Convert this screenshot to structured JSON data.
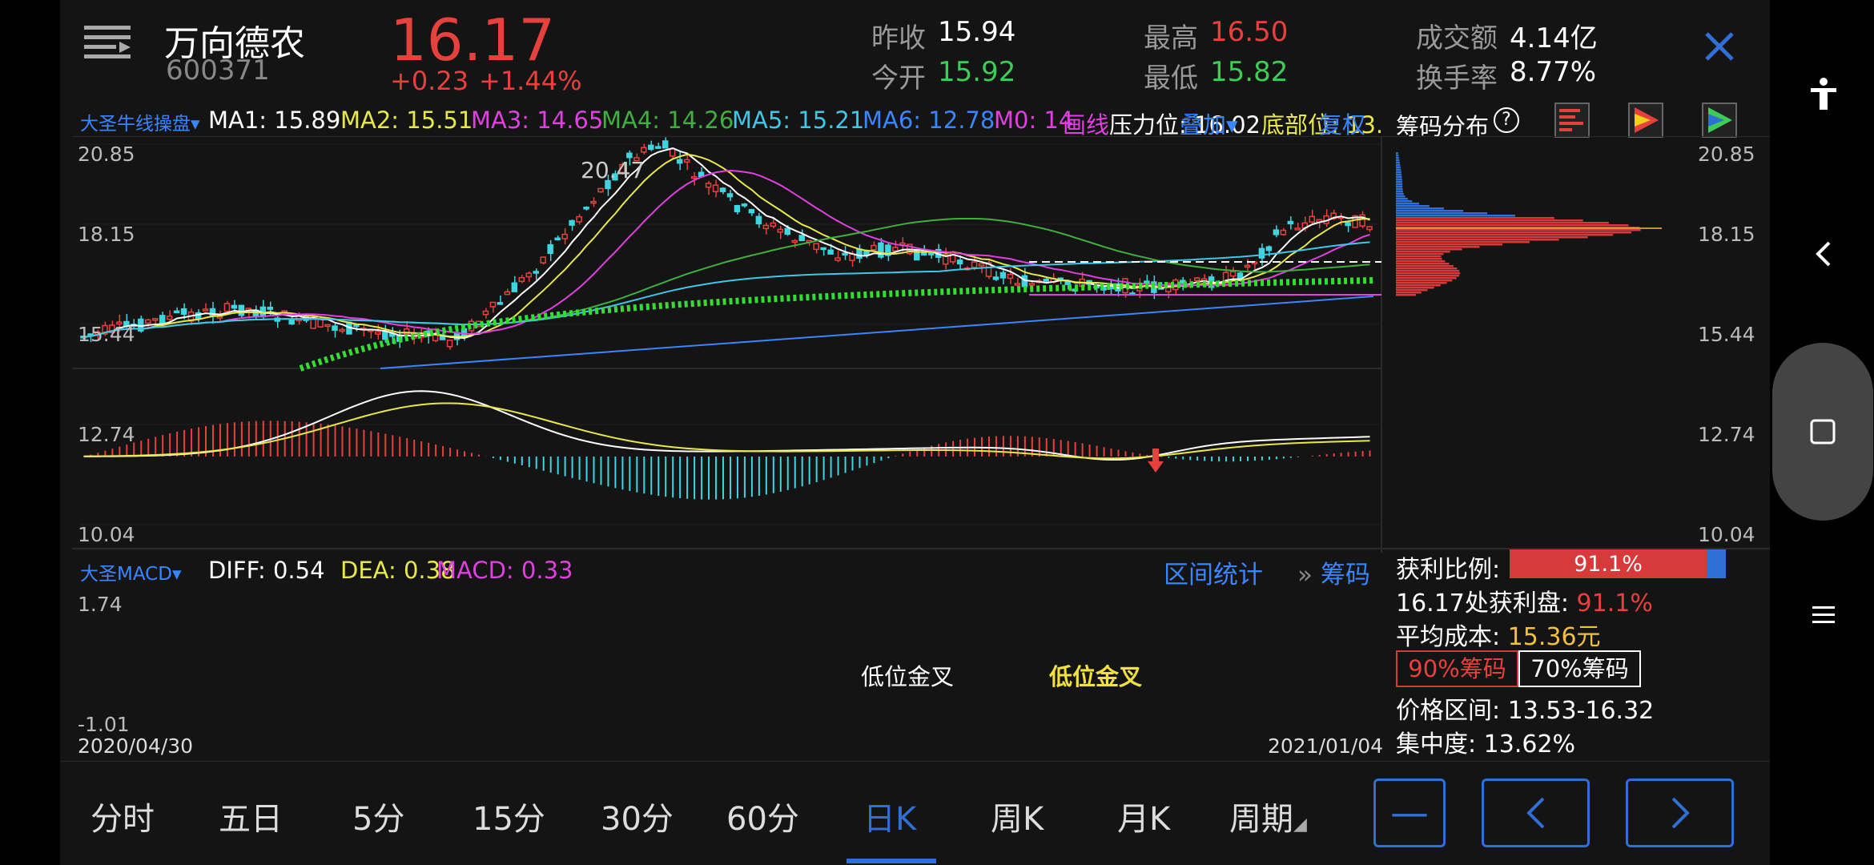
{
  "header": {
    "stock_name": "万向德农",
    "stock_code": "600371",
    "price": "16.17",
    "change": "+0.23",
    "change_pct": "+1.44%",
    "stats": [
      {
        "label": "昨收",
        "value": "15.94",
        "color": "#ffffff"
      },
      {
        "label": "今开",
        "value": "15.92",
        "color": "#3dcc55"
      },
      {
        "label": "最高",
        "value": "16.50",
        "color": "#e8413d"
      },
      {
        "label": "最低",
        "value": "15.82",
        "color": "#3dcc55"
      },
      {
        "label": "成交额",
        "value": "4.14亿",
        "color": "#ffffff"
      },
      {
        "label": "换手率",
        "value": "8.77%",
        "color": "#ffffff"
      }
    ]
  },
  "ma_bar": {
    "indicator": "大圣牛线操盘▾",
    "items": [
      {
        "text": "MA1: 15.89",
        "color": "#ffffff"
      },
      {
        "text": "MA2: 15.51",
        "color": "#e8e84a"
      },
      {
        "text": "MA3: 14.65",
        "color": "#e040e0"
      },
      {
        "text": "MA4: 14.26",
        "color": "#3fb03f"
      },
      {
        "text": "MA5: 15.21",
        "color": "#3fc6e8"
      },
      {
        "text": "MA6: 12.78",
        "color": "#3a86ff"
      },
      {
        "text": "M0: 14",
        "color": "#e040e0"
      },
      {
        "text": "画线",
        "color": "#e040e0"
      },
      {
        "text": "压力位: 16.02",
        "color": "#ffffff"
      },
      {
        "text": "叠加▾",
        "color": "#3a86ff"
      },
      {
        "text": "底部位: 13.",
        "color": "#e8e84a"
      },
      {
        "text": "复权",
        "color": "#3a86ff"
      }
    ]
  },
  "chip_panel": {
    "title": "筹码分布",
    "help": "?",
    "profit_ratio_label": "获利比例:",
    "profit_ratio_value": "91.1%",
    "profit_at_label": "16.17处获利盘:",
    "profit_at_value": "91.1%",
    "avg_cost_label": "平均成本:",
    "avg_cost_value": "15.36元",
    "tab_90": "90%筹码",
    "tab_70": "70%筹码",
    "range_label": "价格区间:",
    "range_value": "13.53-16.32",
    "concentration_label": "集中度:",
    "concentration_value": "13.62%"
  },
  "price_axis": [
    "20.85",
    "18.15",
    "15.44",
    "12.74",
    "10.04"
  ],
  "high_marker": "20.47",
  "macd_bar": {
    "indicator": "大圣MACD▾",
    "diff": "DIFF: 0.54",
    "dea": "DEA: 0.38",
    "macd": "MACD: 0.33",
    "stats_link": "区间统计",
    "chips_link": "筹码",
    "axis_top": "1.74",
    "axis_bottom": "-1.01",
    "annot1": "低位金叉",
    "annot2": "低位金叉"
  },
  "dates": {
    "start": "2020/04/30",
    "end": "2021/01/04"
  },
  "tabs": [
    "分时",
    "五日",
    "5分",
    "15分",
    "30分",
    "60分",
    "日K",
    "周K",
    "月K",
    "周期"
  ],
  "active_tab": "日K",
  "colors": {
    "up": "#e8413d",
    "down": "#3dd6e0",
    "accent": "#2f6fd6",
    "bg": "#141414"
  }
}
